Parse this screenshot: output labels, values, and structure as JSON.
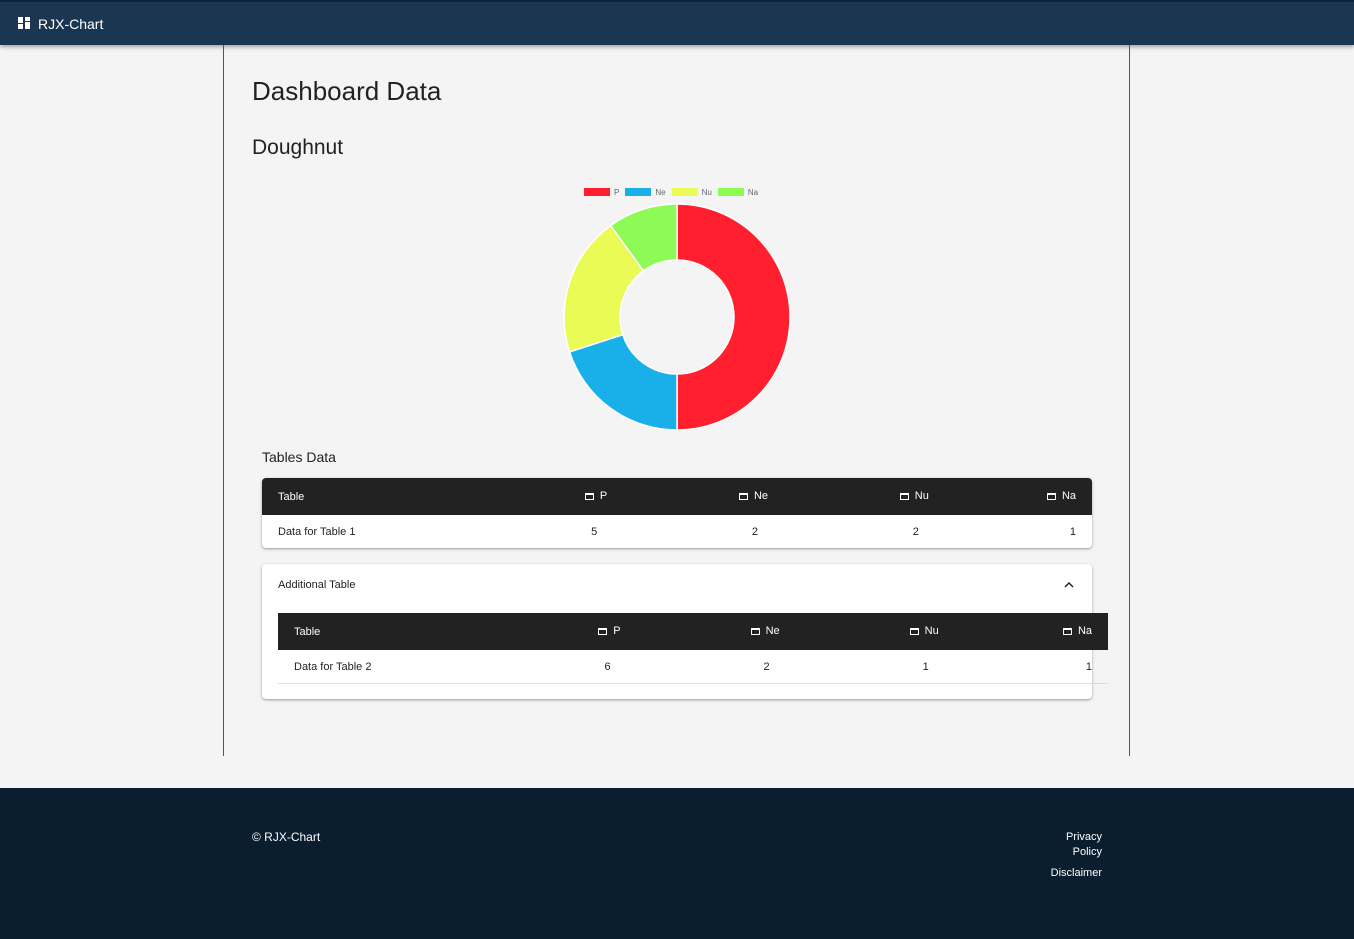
{
  "app": {
    "title": "RJX-Chart",
    "icon": "dashboard-icon"
  },
  "page": {
    "title": "Dashboard Data",
    "section_title": "Doughnut"
  },
  "chart_data": {
    "type": "doughnut",
    "categories": [
      "P",
      "Ne",
      "Nu",
      "Na"
    ],
    "values": [
      5,
      2,
      2,
      1
    ],
    "colors": [
      "#ff1f2e",
      "#19b0ea",
      "#eafb55",
      "#8dfa55"
    ],
    "legend_position": "top"
  },
  "tables": {
    "title": "Tables Data",
    "columns": [
      "Table",
      "P",
      "Ne",
      "Nu",
      "Na"
    ],
    "table1": {
      "row": [
        "Data for Table 1",
        "5",
        "2",
        "2",
        "1"
      ]
    },
    "additional": {
      "title": "Additional Table",
      "expanded": true,
      "row": [
        "Data for Table 2",
        "6",
        "2",
        "1",
        "1"
      ]
    }
  },
  "footer": {
    "copyright": "© RJX-Chart",
    "links": [
      "Privacy Policy",
      "Disclaimer"
    ]
  },
  "colors": {
    "appbar": "#1b3650",
    "footer": "#0a1e30",
    "table_header": "#222222",
    "background": "#f4f4f4"
  }
}
